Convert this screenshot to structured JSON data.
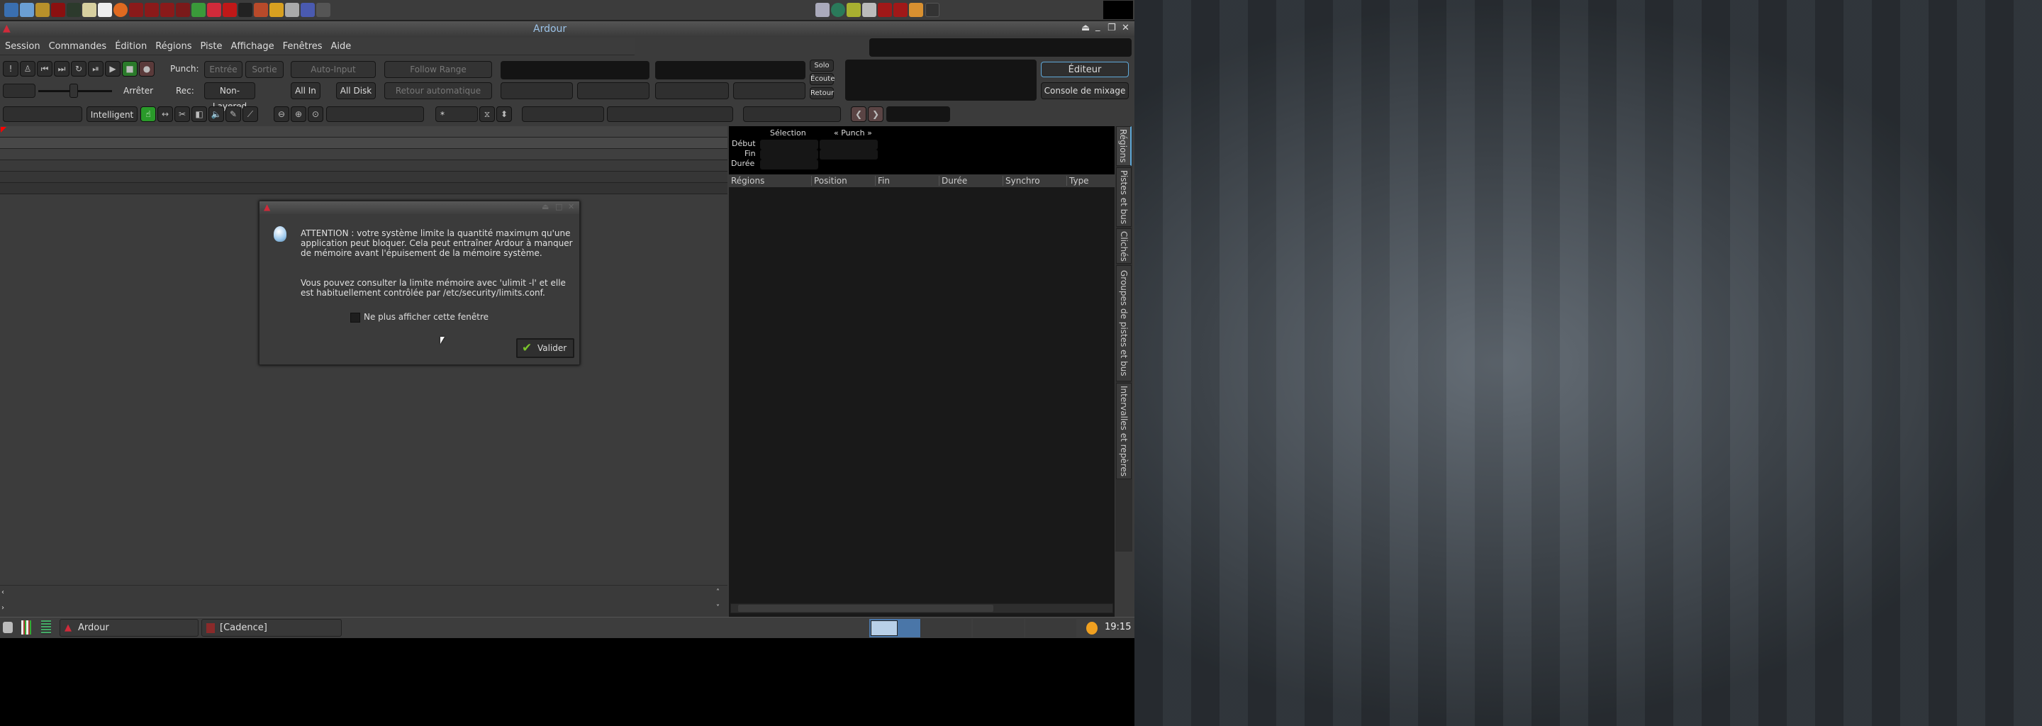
{
  "window": {
    "title": "Ardour"
  },
  "menu": [
    "Session",
    "Commandes",
    "Édition",
    "Régions",
    "Piste",
    "Affichage",
    "Fenêtres",
    "Aide"
  ],
  "transport": {
    "punch_label": "Punch:",
    "punch_in": "Entrée",
    "punch_out": "Sortie",
    "auto_input": "Auto-Input",
    "follow_range": "Follow Range",
    "rec_label": "Rec:",
    "rec_mode": "Non-Layered",
    "all_in": "All In",
    "all_disk": "All Disk",
    "auto_return": "Retour automatique",
    "stop_label": "Arrêter",
    "solo": "Solo",
    "listen": "Écoute",
    "feedback": "Retour",
    "editor": "Éditeur",
    "mixer": "Console de mixage"
  },
  "edit_toolbar": {
    "mode": "Intelligent",
    "snap": "*"
  },
  "selection": {
    "col_selection": "Sélection",
    "col_punch": "« Punch »",
    "row_start": "Début",
    "row_end": "Fin",
    "row_length": "Durée"
  },
  "regions": {
    "columns": [
      "Régions",
      "Position",
      "Fin",
      "Durée",
      "Synchro",
      "Type"
    ]
  },
  "sidebar_tabs": [
    "Régions",
    "Pistes et bus",
    "Clichés",
    "Groupes de pistes et bus",
    "Intervalles et repères"
  ],
  "dialog": {
    "text1": "ATTENTION : votre système limite la quantité maximum qu'une application peut bloquer. Cela peut entraîner Ardour à manquer de mémoire avant l'épuisement de la mémoire système.",
    "text2": "Vous pouvez consulter la limite mémoire avec 'ulimit -l' et elle est habituellement contrôlée par  /etc/security/limits.conf.",
    "checkbox": "Ne plus afficher cette fenêtre",
    "ok": "Valider"
  },
  "taskbar": {
    "items": [
      "Ardour",
      "[Cadence]"
    ],
    "clock": "19:15"
  },
  "colors": {
    "accent": "#5fa8d8",
    "rec": "#d03030",
    "green": "#2a9a2a"
  }
}
